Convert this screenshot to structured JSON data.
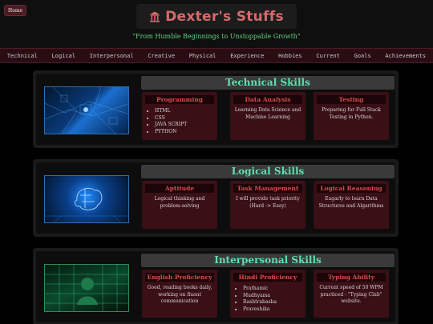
{
  "header": {
    "home_label": "Home",
    "title": "Dexter's Stuffs",
    "tagline": "\"From Humble Beginnings to Unstoppable Growth\""
  },
  "nav": [
    "Technical",
    "Logical",
    "Interpersonal",
    "Creative",
    "Physical",
    "Experience",
    "Hobbies",
    "Current",
    "Goals",
    "Achievements"
  ],
  "sections": [
    {
      "title": "Technical Skills",
      "cards": [
        {
          "title": "Programming",
          "items": [
            "HTML",
            "CSS",
            "JAVA SCRIPT",
            "PYTHON"
          ]
        },
        {
          "title": "Data Analysis",
          "text": "Learning Data Science and Machine Learning"
        },
        {
          "title": "Testing",
          "text": "Preparing for Full Stack Testing in Python."
        }
      ]
    },
    {
      "title": "Logical Skills",
      "cards": [
        {
          "title": "Aptitude",
          "text": "Logical thinking and problem-solving"
        },
        {
          "title": "Task Management",
          "text": "I will provide task priority (Hard -> Easy)"
        },
        {
          "title": "Logical Reasoning",
          "text": "Eagarly to learn Data Structures and Algarithms"
        }
      ]
    },
    {
      "title": "Interpersonal Skills",
      "cards": [
        {
          "title": "English Proficiency",
          "text": "Good, reading books daily, working on fluent communication"
        },
        {
          "title": "Hindi Proficiency",
          "items": [
            "Prathamic",
            "Mudhyama",
            "Rashtrabasha",
            "Praveshika"
          ]
        },
        {
          "title": "Typing Ability",
          "text": "Current speed of 50 WPM practiced - \"Typing Club\" website."
        }
      ]
    }
  ],
  "colors": {
    "accent": "#d56b6b",
    "section_title": "#5fe0b0",
    "tagline": "#62d47f",
    "card_bg": "#3a0f15"
  },
  "icons": {
    "brand": "temple-icon"
  }
}
